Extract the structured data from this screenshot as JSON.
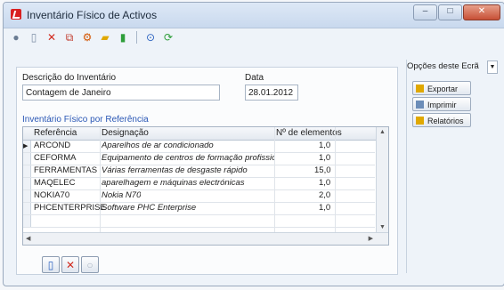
{
  "window": {
    "title": "Inventário Físico de Activos"
  },
  "toolbar": {
    "items": [
      "new-icon",
      "delete-icon",
      "copy-icon",
      "tools-icon",
      "folder-icon",
      "chart-icon",
      "info-icon",
      "refresh-icon"
    ]
  },
  "form": {
    "description_label": "Descrição do Inventário",
    "description_value": "Contagem de Janeiro",
    "date_label": "Data",
    "date_value": "28.01.2012",
    "section_title": "Inventário Físico por Referência"
  },
  "grid": {
    "headers": {
      "ref": "Referência",
      "desc": "Designação",
      "qty": "Nº de elementos"
    },
    "rows": [
      {
        "ref": "ARCOND",
        "desc": "Aparelhos de ar condicionado",
        "qty": "1,0"
      },
      {
        "ref": "CEFORMA",
        "desc": "Equipamento de centros de formação profissional",
        "qty": "1,0"
      },
      {
        "ref": "FERRAMENTAS",
        "desc": "Várias ferramentas de desgaste rápido",
        "qty": "15,0"
      },
      {
        "ref": "MAQELEC",
        "desc": "aparelhagem e máquinas electrónicas",
        "qty": "1,0"
      },
      {
        "ref": "NOKIA70",
        "desc": "Nokia N70",
        "qty": "2,0"
      },
      {
        "ref": "PHCENTERPRISE",
        "desc": "Software PHC Enterprise",
        "qty": "1,0"
      }
    ]
  },
  "side": {
    "options_label": "Opções deste Ecrã",
    "buttons": {
      "export": "Exportar",
      "print": "Imprimir",
      "reports": "Relatórios"
    }
  },
  "colors": {
    "accent": "#2a57b5",
    "close": "#c75036"
  }
}
